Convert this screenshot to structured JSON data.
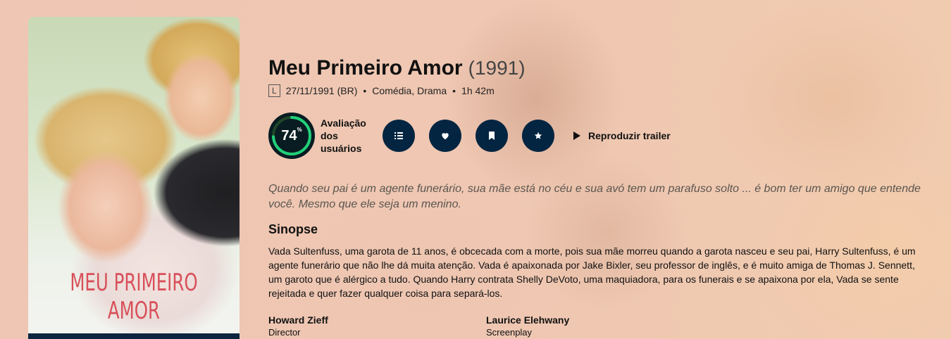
{
  "poster": {
    "title_text": "MEU PRIMEIRO AMOR"
  },
  "movie": {
    "title": "Meu Primeiro Amor",
    "year": "(1991)",
    "certification": "L",
    "release": "27/11/1991 (BR)",
    "genres": "Comédia, Drama",
    "runtime": "1h 42m",
    "separator": "•"
  },
  "score": {
    "value": "74",
    "value_fraction": 0.74,
    "suffix": "%",
    "label_lines": [
      "Avaliação",
      "dos",
      "usuários"
    ],
    "ring_color": "#21d07a",
    "track_color": "#204529"
  },
  "actions": {
    "buttons": [
      {
        "icon": "list-icon"
      },
      {
        "icon": "heart-icon"
      },
      {
        "icon": "bookmark-icon"
      },
      {
        "icon": "star-icon"
      }
    ],
    "trailer_label": "Reproduzir trailer",
    "button_color": "#032541"
  },
  "tagline": "Quando seu pai é um agente funerário, sua mãe está no céu e sua avó tem um parafuso solto ... é bom ter um amigo que entende você. Mesmo que ele seja um menino.",
  "overview": {
    "heading": "Sinopse",
    "text": "Vada Sultenfuss, uma garota de 11 anos, é obcecada com a morte, pois sua mãe morreu quando a garota nasceu e seu pai, Harry Sultenfuss, é um agente funerário que não lhe dá muita atenção. Vada é apaixonada por Jake Bixler, seu professor de inglês, e é muito amiga de Thomas J. Sennett, um garoto que é alérgico a tudo. Quando Harry contrata Shelly DeVoto, uma maquiadora, para os funerais e se apaixona por ela, Vada se sente rejeitada e quer fazer qualquer coisa para separá-los."
  },
  "crew": [
    {
      "name": "Howard Zieff",
      "role": "Director"
    },
    {
      "name": "Laurice Elehwany",
      "role": "Screenplay"
    }
  ]
}
